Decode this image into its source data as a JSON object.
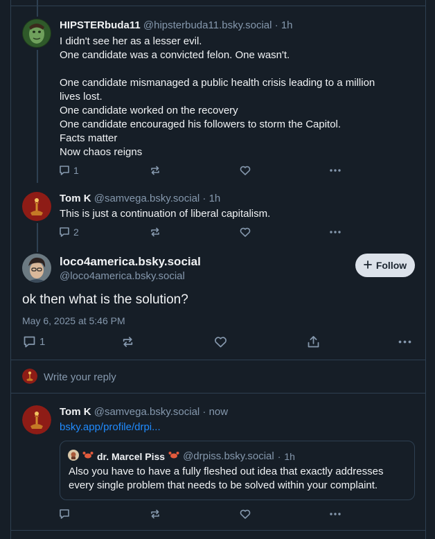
{
  "reply1": {
    "author_name": "HIPSTERbuda11",
    "author_handle": "@hipsterbuda11.bsky.social",
    "separator": "·",
    "time": "1h",
    "text": "I didn't see her as a lesser evil.\nOne candidate was a convicted felon. One wasn't.\n\nOne candidate mismanaged a public health crisis leading to a million lives lost.\nOne candidate worked on the recovery\nOne candidate encouraged his followers to storm the Capitol.\nFacts matter\nNow chaos reigns",
    "reply_count": "1"
  },
  "reply2": {
    "author_name": "Tom K",
    "author_handle": "@samvega.bsky.social",
    "separator": "·",
    "time": "1h",
    "text": "This is just a continuation of liberal capitalism.",
    "reply_count": "2"
  },
  "main_post": {
    "author_name": "loco4america.bsky.social",
    "author_handle": "@loco4america.bsky.social",
    "follow_label": "Follow",
    "follow_icon": "plus-icon",
    "text": "ok then what is the solution?",
    "timestamp": "May 6, 2025 at 5:46 PM",
    "reply_count": "1"
  },
  "composer": {
    "placeholder": "Write your reply"
  },
  "reply3": {
    "author_name": "Tom K",
    "author_handle": "@samvega.bsky.social",
    "separator": "·",
    "time": "now",
    "link_text": "bsky.app/profile/drpi...",
    "quote": {
      "author_name": "dr. Marcel Piss",
      "author_handle": "@drpiss.bsky.social",
      "separator": "·",
      "time": "1h",
      "text": "Also you have to have a fully fleshed out idea that exactly addresses every single problem that needs to be solved within your complaint."
    }
  },
  "colors": {
    "background": "#161e27",
    "border": "#2e4052",
    "muted_text": "#8598ad",
    "link": "#208bfe",
    "follow_bg": "#dce2ea"
  }
}
